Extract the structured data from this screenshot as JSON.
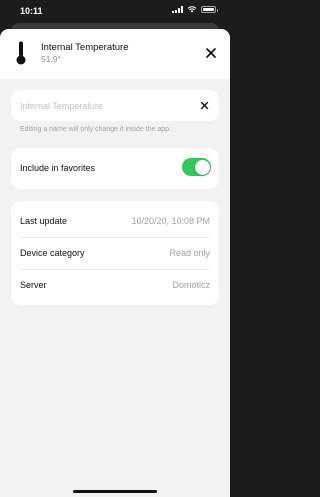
{
  "status_bar": {
    "time": "10:11"
  },
  "header": {
    "icon": "thermometer-icon",
    "title": "Internal Temperature",
    "subtitle": "51.9°",
    "close_icon": "close-icon"
  },
  "name_field": {
    "placeholder": "Internal Temperature",
    "value": "",
    "clear_icon": "clear-icon",
    "hint": "Editing a name will only change it inside the app."
  },
  "favorites": {
    "label": "Include in favorites",
    "enabled": true,
    "toggle_color": "#34c759"
  },
  "info": {
    "rows": [
      {
        "label": "Last update",
        "value": "10/20/20, 10:08 PM"
      },
      {
        "label": "Device category",
        "value": "Read only"
      },
      {
        "label": "Server",
        "value": "Domoticz"
      }
    ]
  }
}
